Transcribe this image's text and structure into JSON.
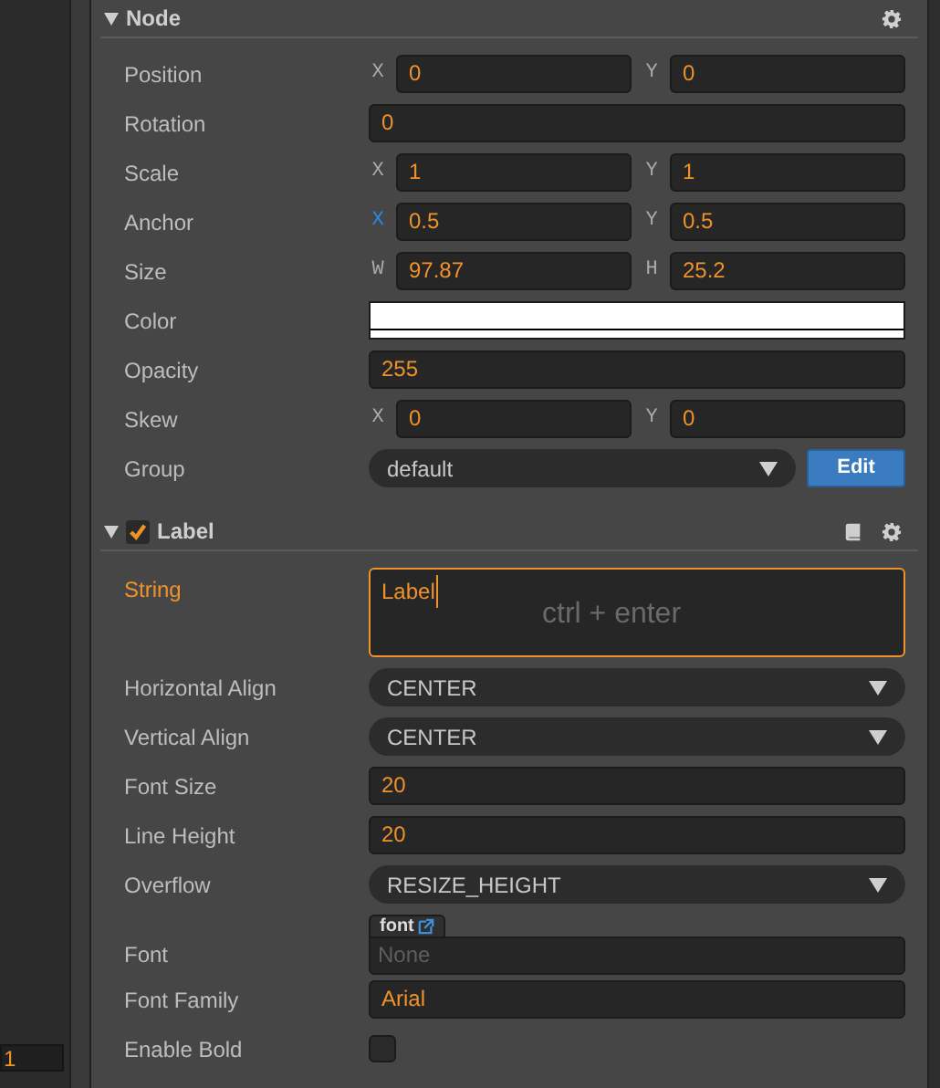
{
  "left_field": {
    "value": "1"
  },
  "sections": [
    {
      "title": "Node",
      "expanded": true,
      "help": false,
      "props": [
        {
          "kind": "vec2",
          "label": "Position",
          "active": false,
          "axes": [
            {
              "axis": "X",
              "value": "0",
              "active": false
            },
            {
              "axis": "Y",
              "value": "0",
              "active": false
            }
          ]
        },
        {
          "kind": "number",
          "label": "Rotation",
          "active": false,
          "value": "0"
        },
        {
          "kind": "vec2",
          "label": "Scale",
          "active": false,
          "axes": [
            {
              "axis": "X",
              "value": "1",
              "active": false
            },
            {
              "axis": "Y",
              "value": "1",
              "active": false
            }
          ]
        },
        {
          "kind": "vec2",
          "label": "Anchor",
          "active": false,
          "axes": [
            {
              "axis": "X",
              "value": "0.5",
              "active": true
            },
            {
              "axis": "Y",
              "value": "0.5",
              "active": false
            }
          ]
        },
        {
          "kind": "vec2",
          "label": "Size",
          "active": false,
          "axes": [
            {
              "axis": "W",
              "value": "97.87",
              "active": false
            },
            {
              "axis": "H",
              "value": "25.2",
              "active": false
            }
          ]
        },
        {
          "kind": "color",
          "label": "Color",
          "active": false,
          "color": "#ffffff"
        },
        {
          "kind": "number",
          "label": "Opacity",
          "active": false,
          "value": "255"
        },
        {
          "kind": "vec2",
          "label": "Skew",
          "active": false,
          "axes": [
            {
              "axis": "X",
              "value": "0",
              "active": false
            },
            {
              "axis": "Y",
              "value": "0",
              "active": false
            }
          ]
        },
        {
          "kind": "select",
          "label": "Group",
          "active": false,
          "value": "default",
          "button": "Edit"
        }
      ]
    },
    {
      "title": "Label",
      "expanded": true,
      "enabled": true,
      "help": true,
      "props": [
        {
          "kind": "textarea",
          "label": "String",
          "active": true,
          "value": "Label",
          "hint": "ctrl + enter"
        },
        {
          "kind": "select",
          "label": "Horizontal Align",
          "active": false,
          "value": "CENTER"
        },
        {
          "kind": "select",
          "label": "Vertical Align",
          "active": false,
          "value": "CENTER"
        },
        {
          "kind": "number",
          "label": "Font Size",
          "active": false,
          "value": "20"
        },
        {
          "kind": "number",
          "label": "Line Height",
          "active": false,
          "value": "20"
        },
        {
          "kind": "select",
          "label": "Overflow",
          "active": false,
          "value": "RESIZE_HEIGHT"
        },
        {
          "kind": "asset",
          "label": "Font",
          "active": false,
          "tag": "font",
          "placeholder": "None"
        },
        {
          "kind": "text",
          "label": "Font Family",
          "active": false,
          "value": "Arial"
        },
        {
          "kind": "checkbox",
          "label": "Enable Bold",
          "active": false,
          "checked": false
        }
      ]
    }
  ]
}
